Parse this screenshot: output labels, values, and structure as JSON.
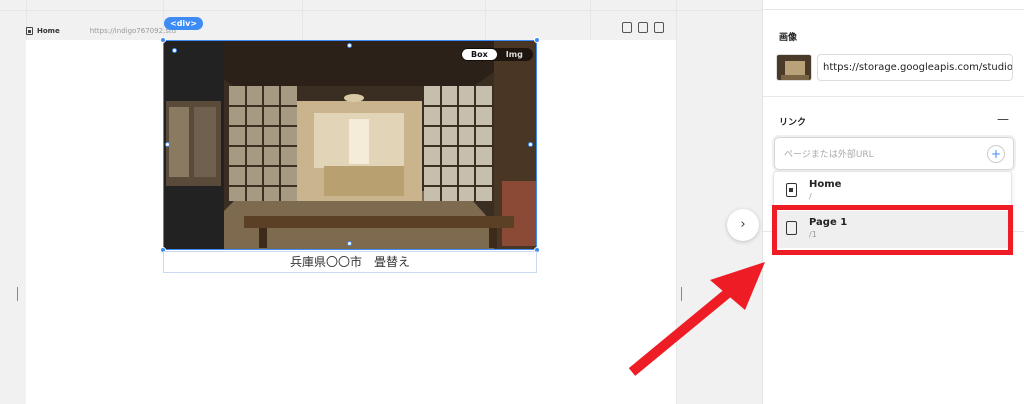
{
  "canvas": {
    "div_tag": "<div>",
    "page_name": "Home",
    "page_url": "https://indigo767092.stu",
    "image_caption": "兵庫県〇〇市　畳替え",
    "toggle": {
      "box": "Box",
      "img": "Img"
    },
    "collapse_label": "›"
  },
  "panel": {
    "image_section_title": "画像",
    "image_url": "https://storage.googleapis.com/studio-c",
    "link_section_title": "リンク",
    "link_placeholder": "ページまたは外部URL",
    "collapse_icon": "—",
    "add_icon": "+",
    "pages": [
      {
        "name": "Home",
        "path": "/"
      },
      {
        "name": "Page 1",
        "path": "/1"
      }
    ]
  },
  "colors": {
    "selection": "#3d8cf5",
    "annotation": "#ee1c24"
  }
}
